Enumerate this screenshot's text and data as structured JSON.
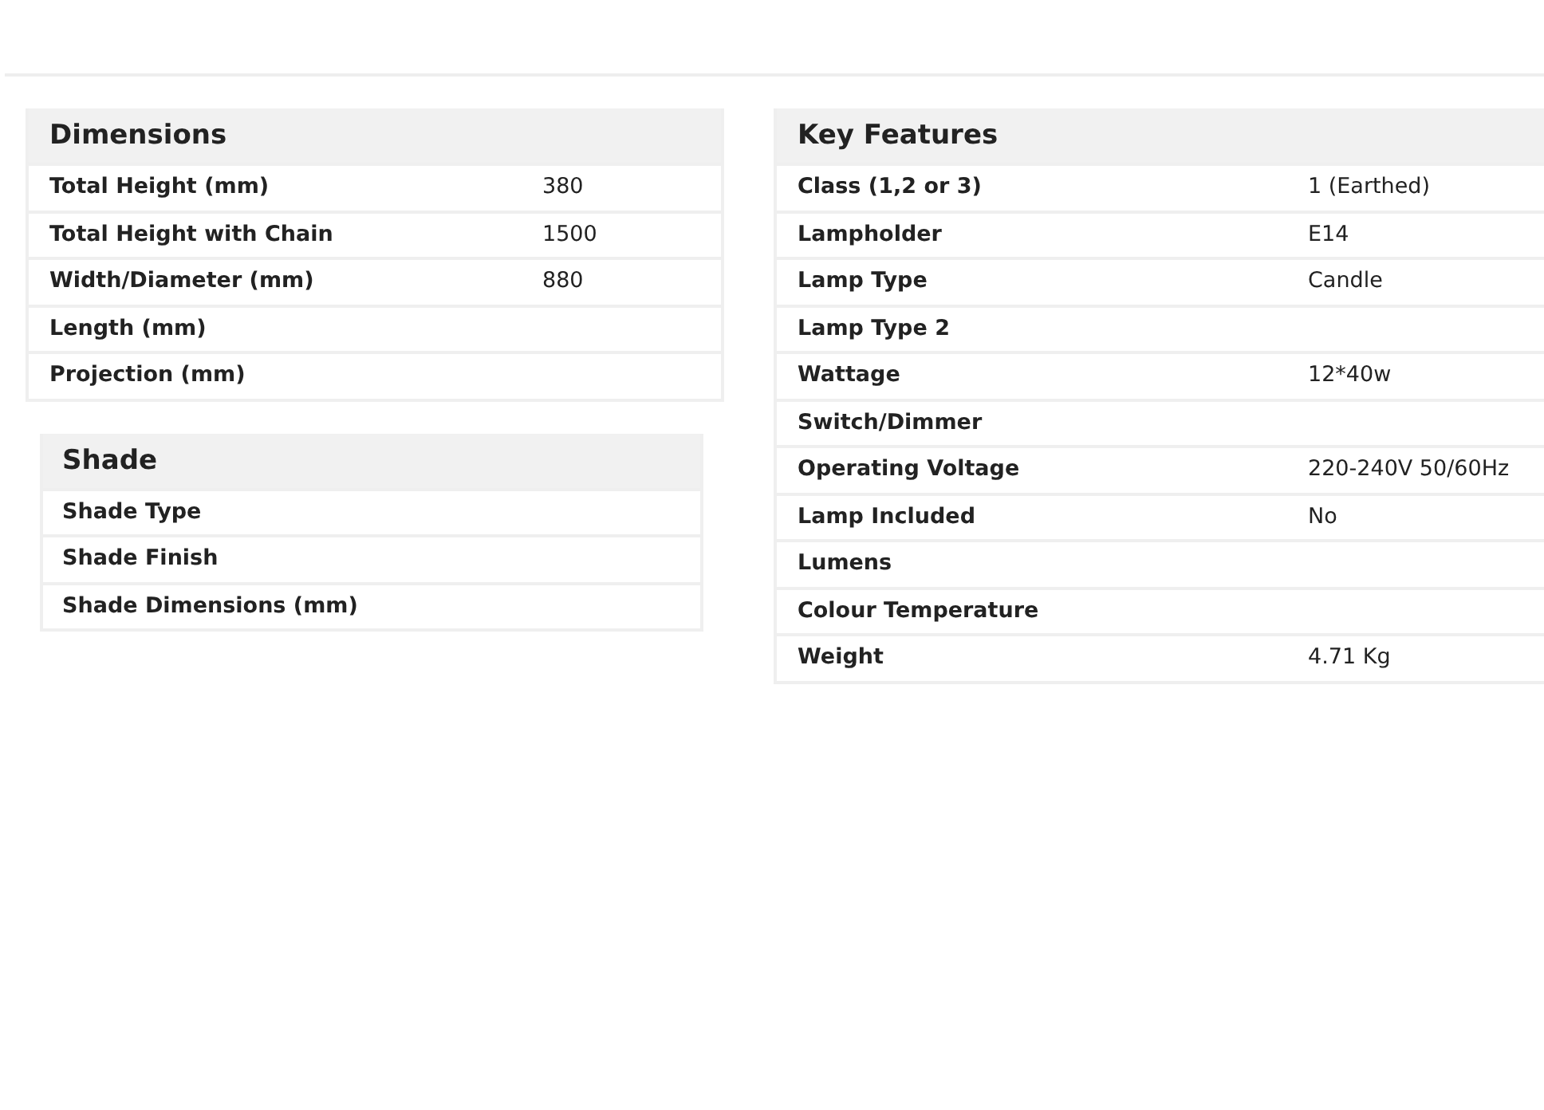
{
  "dimensions": {
    "title": "Dimensions",
    "rows": [
      {
        "label": "Total Height (mm)",
        "value": "380"
      },
      {
        "label": "Total Height with Chain",
        "value": "1500"
      },
      {
        "label": "Width/Diameter (mm)",
        "value": "880"
      },
      {
        "label": "Length (mm)"
      },
      {
        "label": "Projection (mm)"
      }
    ]
  },
  "shade": {
    "title": "Shade",
    "rows": [
      {
        "label": "Shade Type"
      },
      {
        "label": "Shade Finish"
      },
      {
        "label": "Shade Dimensions (mm)"
      }
    ]
  },
  "key_features": {
    "title": "Key Features",
    "rows": [
      {
        "label": "Class (1,2 or 3)",
        "value": "1 (Earthed)"
      },
      {
        "label": "Lampholder",
        "value": "E14"
      },
      {
        "label": "Lamp Type",
        "value": "Candle"
      },
      {
        "label": "Lamp Type 2"
      },
      {
        "label": "Wattage",
        "value": "12*40w"
      },
      {
        "label": "Switch/Dimmer"
      },
      {
        "label": "Operating Voltage",
        "value": "220-240V 50/60Hz"
      },
      {
        "label": "Lamp Included",
        "value": "No"
      },
      {
        "label": "Lumens"
      },
      {
        "label": "Colour Temperature"
      },
      {
        "label": "Weight",
        "value": "4.71 Kg"
      }
    ]
  }
}
